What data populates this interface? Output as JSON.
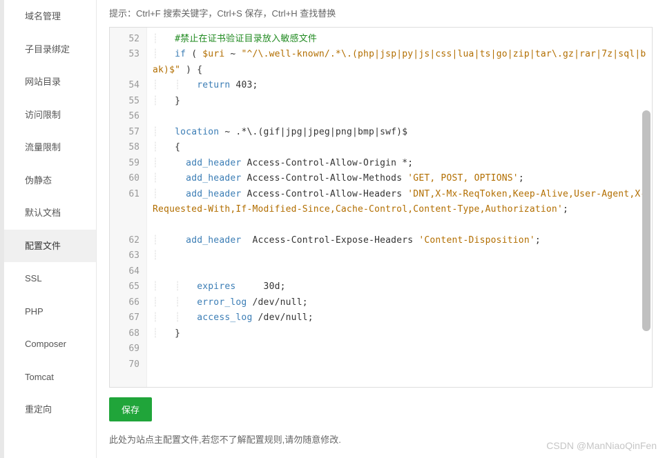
{
  "sidebar": {
    "items": [
      {
        "label": "域名管理"
      },
      {
        "label": "子目录绑定"
      },
      {
        "label": "网站目录"
      },
      {
        "label": "访问限制"
      },
      {
        "label": "流量限制"
      },
      {
        "label": "伪静态"
      },
      {
        "label": "默认文档"
      },
      {
        "label": "配置文件",
        "active": true
      },
      {
        "label": "SSL"
      },
      {
        "label": "PHP"
      },
      {
        "label": "Composer"
      },
      {
        "label": "Tomcat"
      },
      {
        "label": "重定向"
      }
    ]
  },
  "hint": "提示：Ctrl+F 搜索关键字，Ctrl+S 保存，Ctrl+H 查找替换",
  "editor": {
    "first_line": 52,
    "lines": [
      {
        "n": 52,
        "indent": "    ",
        "type": "comment",
        "text": "#禁止在证书验证目录放入敏感文件"
      },
      {
        "n": 53,
        "indent": "    ",
        "type": "if",
        "kw": "if",
        "var": "$uri",
        "op": "~",
        "str": "\"^/\\.well-known/.*\\.(php|jsp|py|js|css|lua|ts|go|zip|tar\\.gz|rar|7z|sql|bak)$\"",
        "tail": " ) {"
      },
      {
        "n": 54,
        "indent": "        ",
        "type": "return",
        "kw": "return",
        "val": "403",
        "tail": ";"
      },
      {
        "n": 55,
        "indent": "    ",
        "type": "plain",
        "text": "}"
      },
      {
        "n": 56,
        "indent": "",
        "type": "blank",
        "text": ""
      },
      {
        "n": 57,
        "indent": "    ",
        "type": "loc",
        "kw": "location",
        "pat": "~ .*\\.(gif|jpg|jpeg|png|bmp|swf)$"
      },
      {
        "n": 58,
        "indent": "    ",
        "type": "plain",
        "text": "{"
      },
      {
        "n": 59,
        "indent": "      ",
        "type": "dir",
        "dir": "add_header",
        "args": "Access-Control-Allow-Origin *",
        "tail": ";"
      },
      {
        "n": 60,
        "indent": "      ",
        "type": "dirs",
        "dir": "add_header",
        "mid": " Access-Control-Allow-Methods ",
        "str": "'GET, POST, OPTIONS'",
        "tail": ";"
      },
      {
        "n": 61,
        "indent": "      ",
        "type": "dirs",
        "dir": "add_header",
        "mid": " Access-Control-Allow-Headers ",
        "str": "'DNT,X-Mx-ReqToken,Keep-Alive,User-Agent,X-Requested-With,If-Modified-Since,Cache-Control,Content-Type,Authorization'",
        "tail": ";"
      },
      {
        "n": 62,
        "indent": "      ",
        "type": "dirs",
        "dir": "add_header",
        "mid": "  Access-Control-Expose-Headers ",
        "str": "'Content-Disposition'",
        "tail": ";"
      },
      {
        "n": 63,
        "indent": "    ",
        "type": "blank",
        "text": ""
      },
      {
        "n": 64,
        "indent": "",
        "type": "blank",
        "text": ""
      },
      {
        "n": 65,
        "indent": "        ",
        "type": "dir",
        "dir": "expires",
        "args": "     30d",
        "tail": ";"
      },
      {
        "n": 66,
        "indent": "        ",
        "type": "dir",
        "dir": "error_log",
        "args": " /dev/null",
        "tail": ";"
      },
      {
        "n": 67,
        "indent": "        ",
        "type": "dir",
        "dir": "access_log",
        "args": " /dev/null",
        "tail": ";"
      },
      {
        "n": 68,
        "indent": "    ",
        "type": "plain",
        "text": "}"
      },
      {
        "n": 69,
        "indent": "",
        "type": "blank",
        "text": ""
      },
      {
        "n": 70,
        "indent": "",
        "type": "blank",
        "text": ""
      }
    ]
  },
  "actions": {
    "save_label": "保存"
  },
  "footer_note": "此处为站点主配置文件,若您不了解配置规则,请勿随意修改.",
  "watermark": "CSDN @ManNiaoQinFen"
}
